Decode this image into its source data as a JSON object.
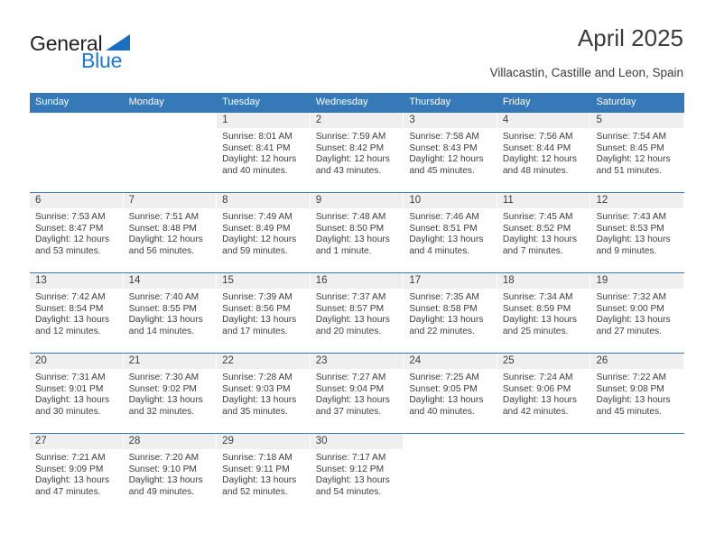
{
  "logo": {
    "word1": "General",
    "word2": "Blue",
    "triangle_color": "#1b6fc1",
    "text_color": "#231f20",
    "blue_color": "#1b7ad1"
  },
  "header": {
    "title": "April 2025",
    "subtitle": "Villacastin, Castille and Leon, Spain"
  },
  "theme": {
    "header_blue": "#3679b9",
    "day_band_gray": "#efefef",
    "text": "#3d3d3d"
  },
  "weekdays": [
    "Sunday",
    "Monday",
    "Tuesday",
    "Wednesday",
    "Thursday",
    "Friday",
    "Saturday"
  ],
  "weeks": [
    [
      {
        "day": "",
        "sunrise": "",
        "sunset": "",
        "daylight1": "",
        "daylight2": ""
      },
      {
        "day": "",
        "sunrise": "",
        "sunset": "",
        "daylight1": "",
        "daylight2": ""
      },
      {
        "day": "1",
        "sunrise": "Sunrise: 8:01 AM",
        "sunset": "Sunset: 8:41 PM",
        "daylight1": "Daylight: 12 hours",
        "daylight2": "and 40 minutes."
      },
      {
        "day": "2",
        "sunrise": "Sunrise: 7:59 AM",
        "sunset": "Sunset: 8:42 PM",
        "daylight1": "Daylight: 12 hours",
        "daylight2": "and 43 minutes."
      },
      {
        "day": "3",
        "sunrise": "Sunrise: 7:58 AM",
        "sunset": "Sunset: 8:43 PM",
        "daylight1": "Daylight: 12 hours",
        "daylight2": "and 45 minutes."
      },
      {
        "day": "4",
        "sunrise": "Sunrise: 7:56 AM",
        "sunset": "Sunset: 8:44 PM",
        "daylight1": "Daylight: 12 hours",
        "daylight2": "and 48 minutes."
      },
      {
        "day": "5",
        "sunrise": "Sunrise: 7:54 AM",
        "sunset": "Sunset: 8:45 PM",
        "daylight1": "Daylight: 12 hours",
        "daylight2": "and 51 minutes."
      }
    ],
    [
      {
        "day": "6",
        "sunrise": "Sunrise: 7:53 AM",
        "sunset": "Sunset: 8:47 PM",
        "daylight1": "Daylight: 12 hours",
        "daylight2": "and 53 minutes."
      },
      {
        "day": "7",
        "sunrise": "Sunrise: 7:51 AM",
        "sunset": "Sunset: 8:48 PM",
        "daylight1": "Daylight: 12 hours",
        "daylight2": "and 56 minutes."
      },
      {
        "day": "8",
        "sunrise": "Sunrise: 7:49 AM",
        "sunset": "Sunset: 8:49 PM",
        "daylight1": "Daylight: 12 hours",
        "daylight2": "and 59 minutes."
      },
      {
        "day": "9",
        "sunrise": "Sunrise: 7:48 AM",
        "sunset": "Sunset: 8:50 PM",
        "daylight1": "Daylight: 13 hours",
        "daylight2": "and 1 minute."
      },
      {
        "day": "10",
        "sunrise": "Sunrise: 7:46 AM",
        "sunset": "Sunset: 8:51 PM",
        "daylight1": "Daylight: 13 hours",
        "daylight2": "and 4 minutes."
      },
      {
        "day": "11",
        "sunrise": "Sunrise: 7:45 AM",
        "sunset": "Sunset: 8:52 PM",
        "daylight1": "Daylight: 13 hours",
        "daylight2": "and 7 minutes."
      },
      {
        "day": "12",
        "sunrise": "Sunrise: 7:43 AM",
        "sunset": "Sunset: 8:53 PM",
        "daylight1": "Daylight: 13 hours",
        "daylight2": "and 9 minutes."
      }
    ],
    [
      {
        "day": "13",
        "sunrise": "Sunrise: 7:42 AM",
        "sunset": "Sunset: 8:54 PM",
        "daylight1": "Daylight: 13 hours",
        "daylight2": "and 12 minutes."
      },
      {
        "day": "14",
        "sunrise": "Sunrise: 7:40 AM",
        "sunset": "Sunset: 8:55 PM",
        "daylight1": "Daylight: 13 hours",
        "daylight2": "and 14 minutes."
      },
      {
        "day": "15",
        "sunrise": "Sunrise: 7:39 AM",
        "sunset": "Sunset: 8:56 PM",
        "daylight1": "Daylight: 13 hours",
        "daylight2": "and 17 minutes."
      },
      {
        "day": "16",
        "sunrise": "Sunrise: 7:37 AM",
        "sunset": "Sunset: 8:57 PM",
        "daylight1": "Daylight: 13 hours",
        "daylight2": "and 20 minutes."
      },
      {
        "day": "17",
        "sunrise": "Sunrise: 7:35 AM",
        "sunset": "Sunset: 8:58 PM",
        "daylight1": "Daylight: 13 hours",
        "daylight2": "and 22 minutes."
      },
      {
        "day": "18",
        "sunrise": "Sunrise: 7:34 AM",
        "sunset": "Sunset: 8:59 PM",
        "daylight1": "Daylight: 13 hours",
        "daylight2": "and 25 minutes."
      },
      {
        "day": "19",
        "sunrise": "Sunrise: 7:32 AM",
        "sunset": "Sunset: 9:00 PM",
        "daylight1": "Daylight: 13 hours",
        "daylight2": "and 27 minutes."
      }
    ],
    [
      {
        "day": "20",
        "sunrise": "Sunrise: 7:31 AM",
        "sunset": "Sunset: 9:01 PM",
        "daylight1": "Daylight: 13 hours",
        "daylight2": "and 30 minutes."
      },
      {
        "day": "21",
        "sunrise": "Sunrise: 7:30 AM",
        "sunset": "Sunset: 9:02 PM",
        "daylight1": "Daylight: 13 hours",
        "daylight2": "and 32 minutes."
      },
      {
        "day": "22",
        "sunrise": "Sunrise: 7:28 AM",
        "sunset": "Sunset: 9:03 PM",
        "daylight1": "Daylight: 13 hours",
        "daylight2": "and 35 minutes."
      },
      {
        "day": "23",
        "sunrise": "Sunrise: 7:27 AM",
        "sunset": "Sunset: 9:04 PM",
        "daylight1": "Daylight: 13 hours",
        "daylight2": "and 37 minutes."
      },
      {
        "day": "24",
        "sunrise": "Sunrise: 7:25 AM",
        "sunset": "Sunset: 9:05 PM",
        "daylight1": "Daylight: 13 hours",
        "daylight2": "and 40 minutes."
      },
      {
        "day": "25",
        "sunrise": "Sunrise: 7:24 AM",
        "sunset": "Sunset: 9:06 PM",
        "daylight1": "Daylight: 13 hours",
        "daylight2": "and 42 minutes."
      },
      {
        "day": "26",
        "sunrise": "Sunrise: 7:22 AM",
        "sunset": "Sunset: 9:08 PM",
        "daylight1": "Daylight: 13 hours",
        "daylight2": "and 45 minutes."
      }
    ],
    [
      {
        "day": "27",
        "sunrise": "Sunrise: 7:21 AM",
        "sunset": "Sunset: 9:09 PM",
        "daylight1": "Daylight: 13 hours",
        "daylight2": "and 47 minutes."
      },
      {
        "day": "28",
        "sunrise": "Sunrise: 7:20 AM",
        "sunset": "Sunset: 9:10 PM",
        "daylight1": "Daylight: 13 hours",
        "daylight2": "and 49 minutes."
      },
      {
        "day": "29",
        "sunrise": "Sunrise: 7:18 AM",
        "sunset": "Sunset: 9:11 PM",
        "daylight1": "Daylight: 13 hours",
        "daylight2": "and 52 minutes."
      },
      {
        "day": "30",
        "sunrise": "Sunrise: 7:17 AM",
        "sunset": "Sunset: 9:12 PM",
        "daylight1": "Daylight: 13 hours",
        "daylight2": "and 54 minutes."
      },
      {
        "day": "",
        "sunrise": "",
        "sunset": "",
        "daylight1": "",
        "daylight2": ""
      },
      {
        "day": "",
        "sunrise": "",
        "sunset": "",
        "daylight1": "",
        "daylight2": ""
      },
      {
        "day": "",
        "sunrise": "",
        "sunset": "",
        "daylight1": "",
        "daylight2": ""
      }
    ]
  ]
}
